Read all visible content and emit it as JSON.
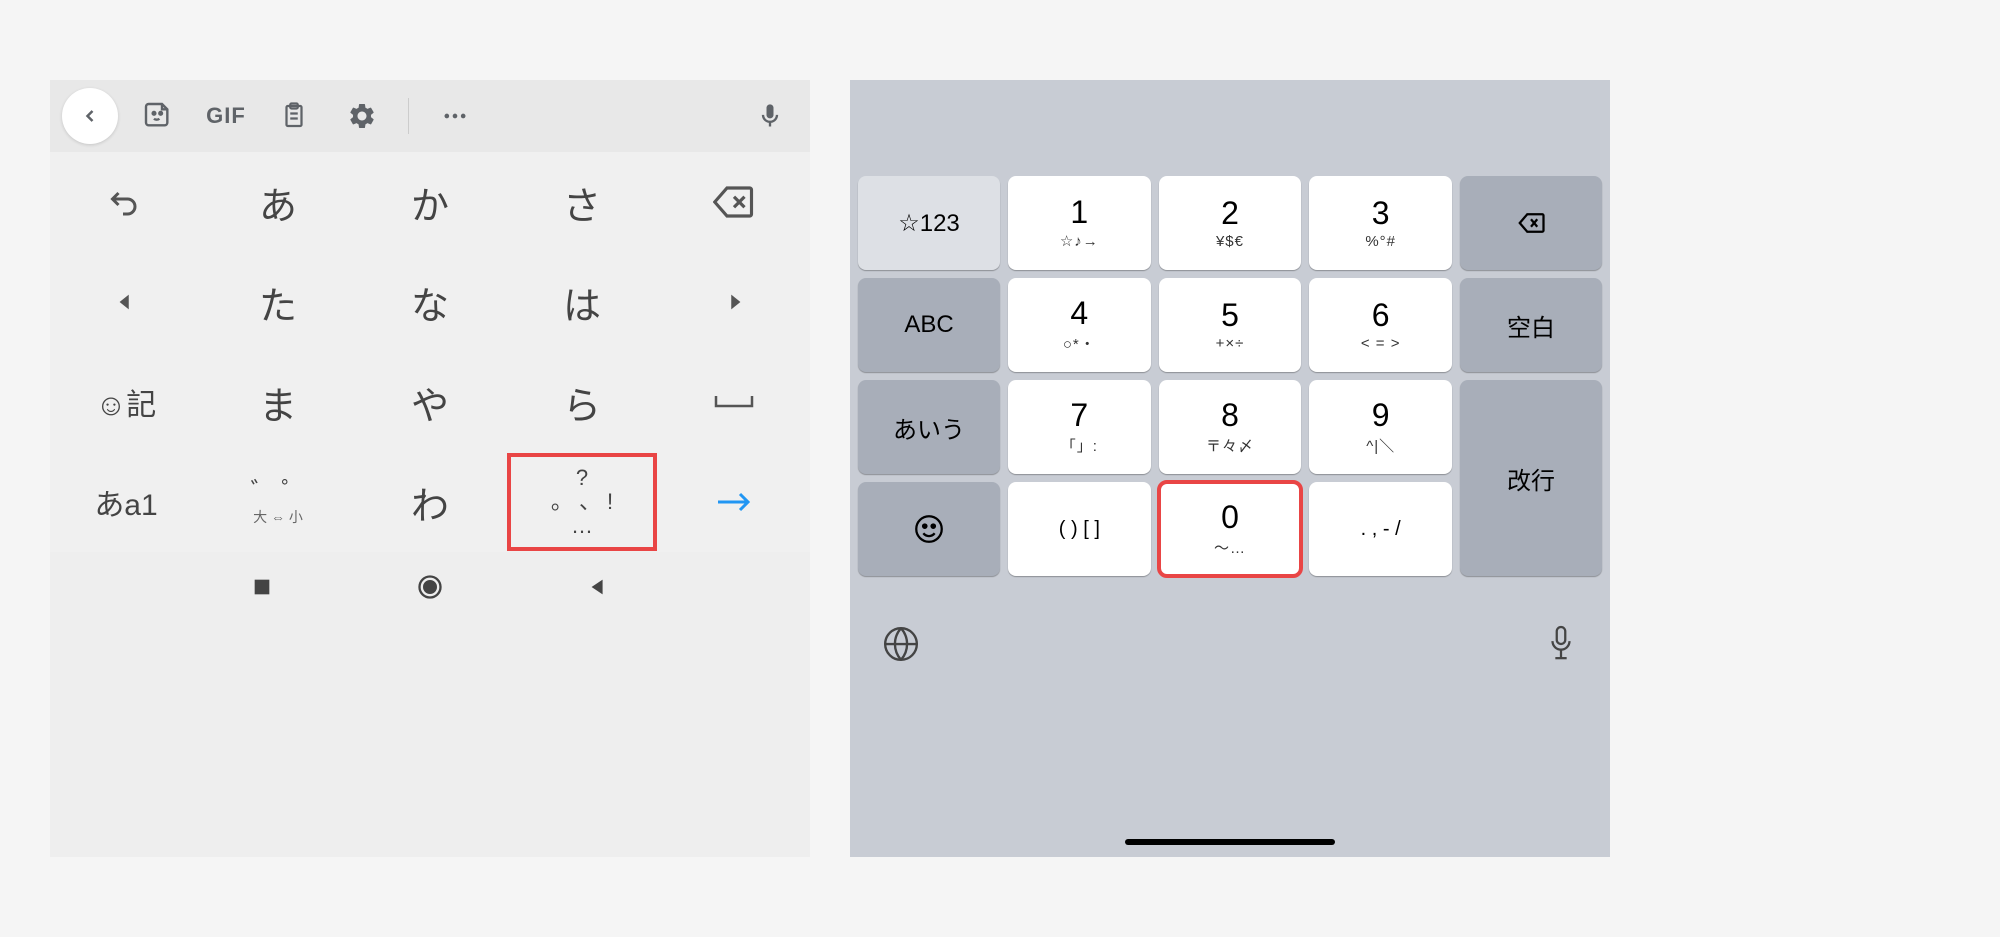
{
  "left": {
    "toolbar": {
      "gif": "GIF"
    },
    "keys": {
      "row1": {
        "k2": "あ",
        "k3": "か",
        "k4": "さ"
      },
      "row2": {
        "k2": "た",
        "k3": "な",
        "k4": "は"
      },
      "row3": {
        "k1": "☺記",
        "k2": "ま",
        "k3": "や",
        "k4": "ら",
        "k5": "⎵"
      },
      "row4": {
        "k1": "あa1",
        "k2_top": "゛ ゜",
        "k2_sub": "大 ⇔ 小",
        "k3": "わ",
        "k4_top": "?",
        "k4_mid": "。 、 !",
        "k4_bot": "…"
      }
    }
  },
  "right": {
    "keys": {
      "topleft": "☆123",
      "num1": "1",
      "num1_sub": "☆♪→",
      "num2": "2",
      "num2_sub": "¥$€",
      "num3": "3",
      "num3_sub": "%°#",
      "abc": "ABC",
      "num4": "4",
      "num4_sub": "○*・",
      "num5": "5",
      "num5_sub": "+×÷",
      "num6": "6",
      "num6_sub": "< = >",
      "space": "空白",
      "kana": "あいう",
      "num7": "7",
      "num7_sub": "「」:",
      "num8": "8",
      "num8_sub": "〒々〆",
      "num9": "9",
      "num9_sub": "^|＼",
      "enter": "改行",
      "paren": "( ) [ ]",
      "num0": "0",
      "num0_sub": "〜…",
      "punct": ". , - /"
    }
  }
}
